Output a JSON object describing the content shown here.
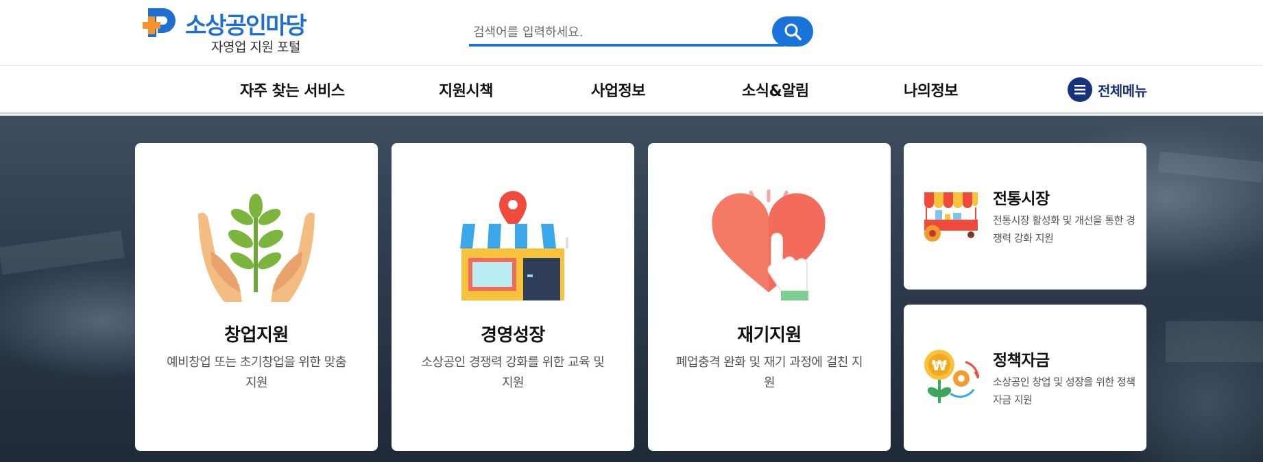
{
  "header": {
    "logo_name": "소상공인마당",
    "logo_subtitle": "자영업 지원 포털",
    "search_placeholder": "검색어를 입력하세요.",
    "search_value": ""
  },
  "nav": {
    "items": [
      {
        "label": "자주 찾는 서비스"
      },
      {
        "label": "지원시책"
      },
      {
        "label": "사업정보"
      },
      {
        "label": "소식&알림"
      },
      {
        "label": "나의정보"
      }
    ],
    "all_menu_label": "전체메뉴"
  },
  "cards": {
    "large": [
      {
        "title": "창업지원",
        "desc": "예비창업 또는 초기창업을 위한 맞춤 지원",
        "icon": "plant-hands-icon"
      },
      {
        "title": "경영성장",
        "desc": "소상공인 경쟁력 강화를 위한 교육 및 지원",
        "icon": "store-pin-icon"
      },
      {
        "title": "재기지원",
        "desc": "폐업충격 완화 및 재기 과정에 걸친 지원",
        "icon": "heart-hand-icon"
      }
    ],
    "small": [
      {
        "title": "전통시장",
        "desc": "전통시장 활성화 및 개선을 통한 경쟁력 강화 지원",
        "icon": "market-cart-icon"
      },
      {
        "title": "정책자금",
        "desc": "소상공인 창업 및 성장을 위한 정책자금 지원",
        "icon": "money-flower-icon"
      }
    ]
  },
  "colors": {
    "brand_blue": "#1a73d9",
    "logo_orange": "#f5942b",
    "nav_dark_blue": "#16327a"
  }
}
